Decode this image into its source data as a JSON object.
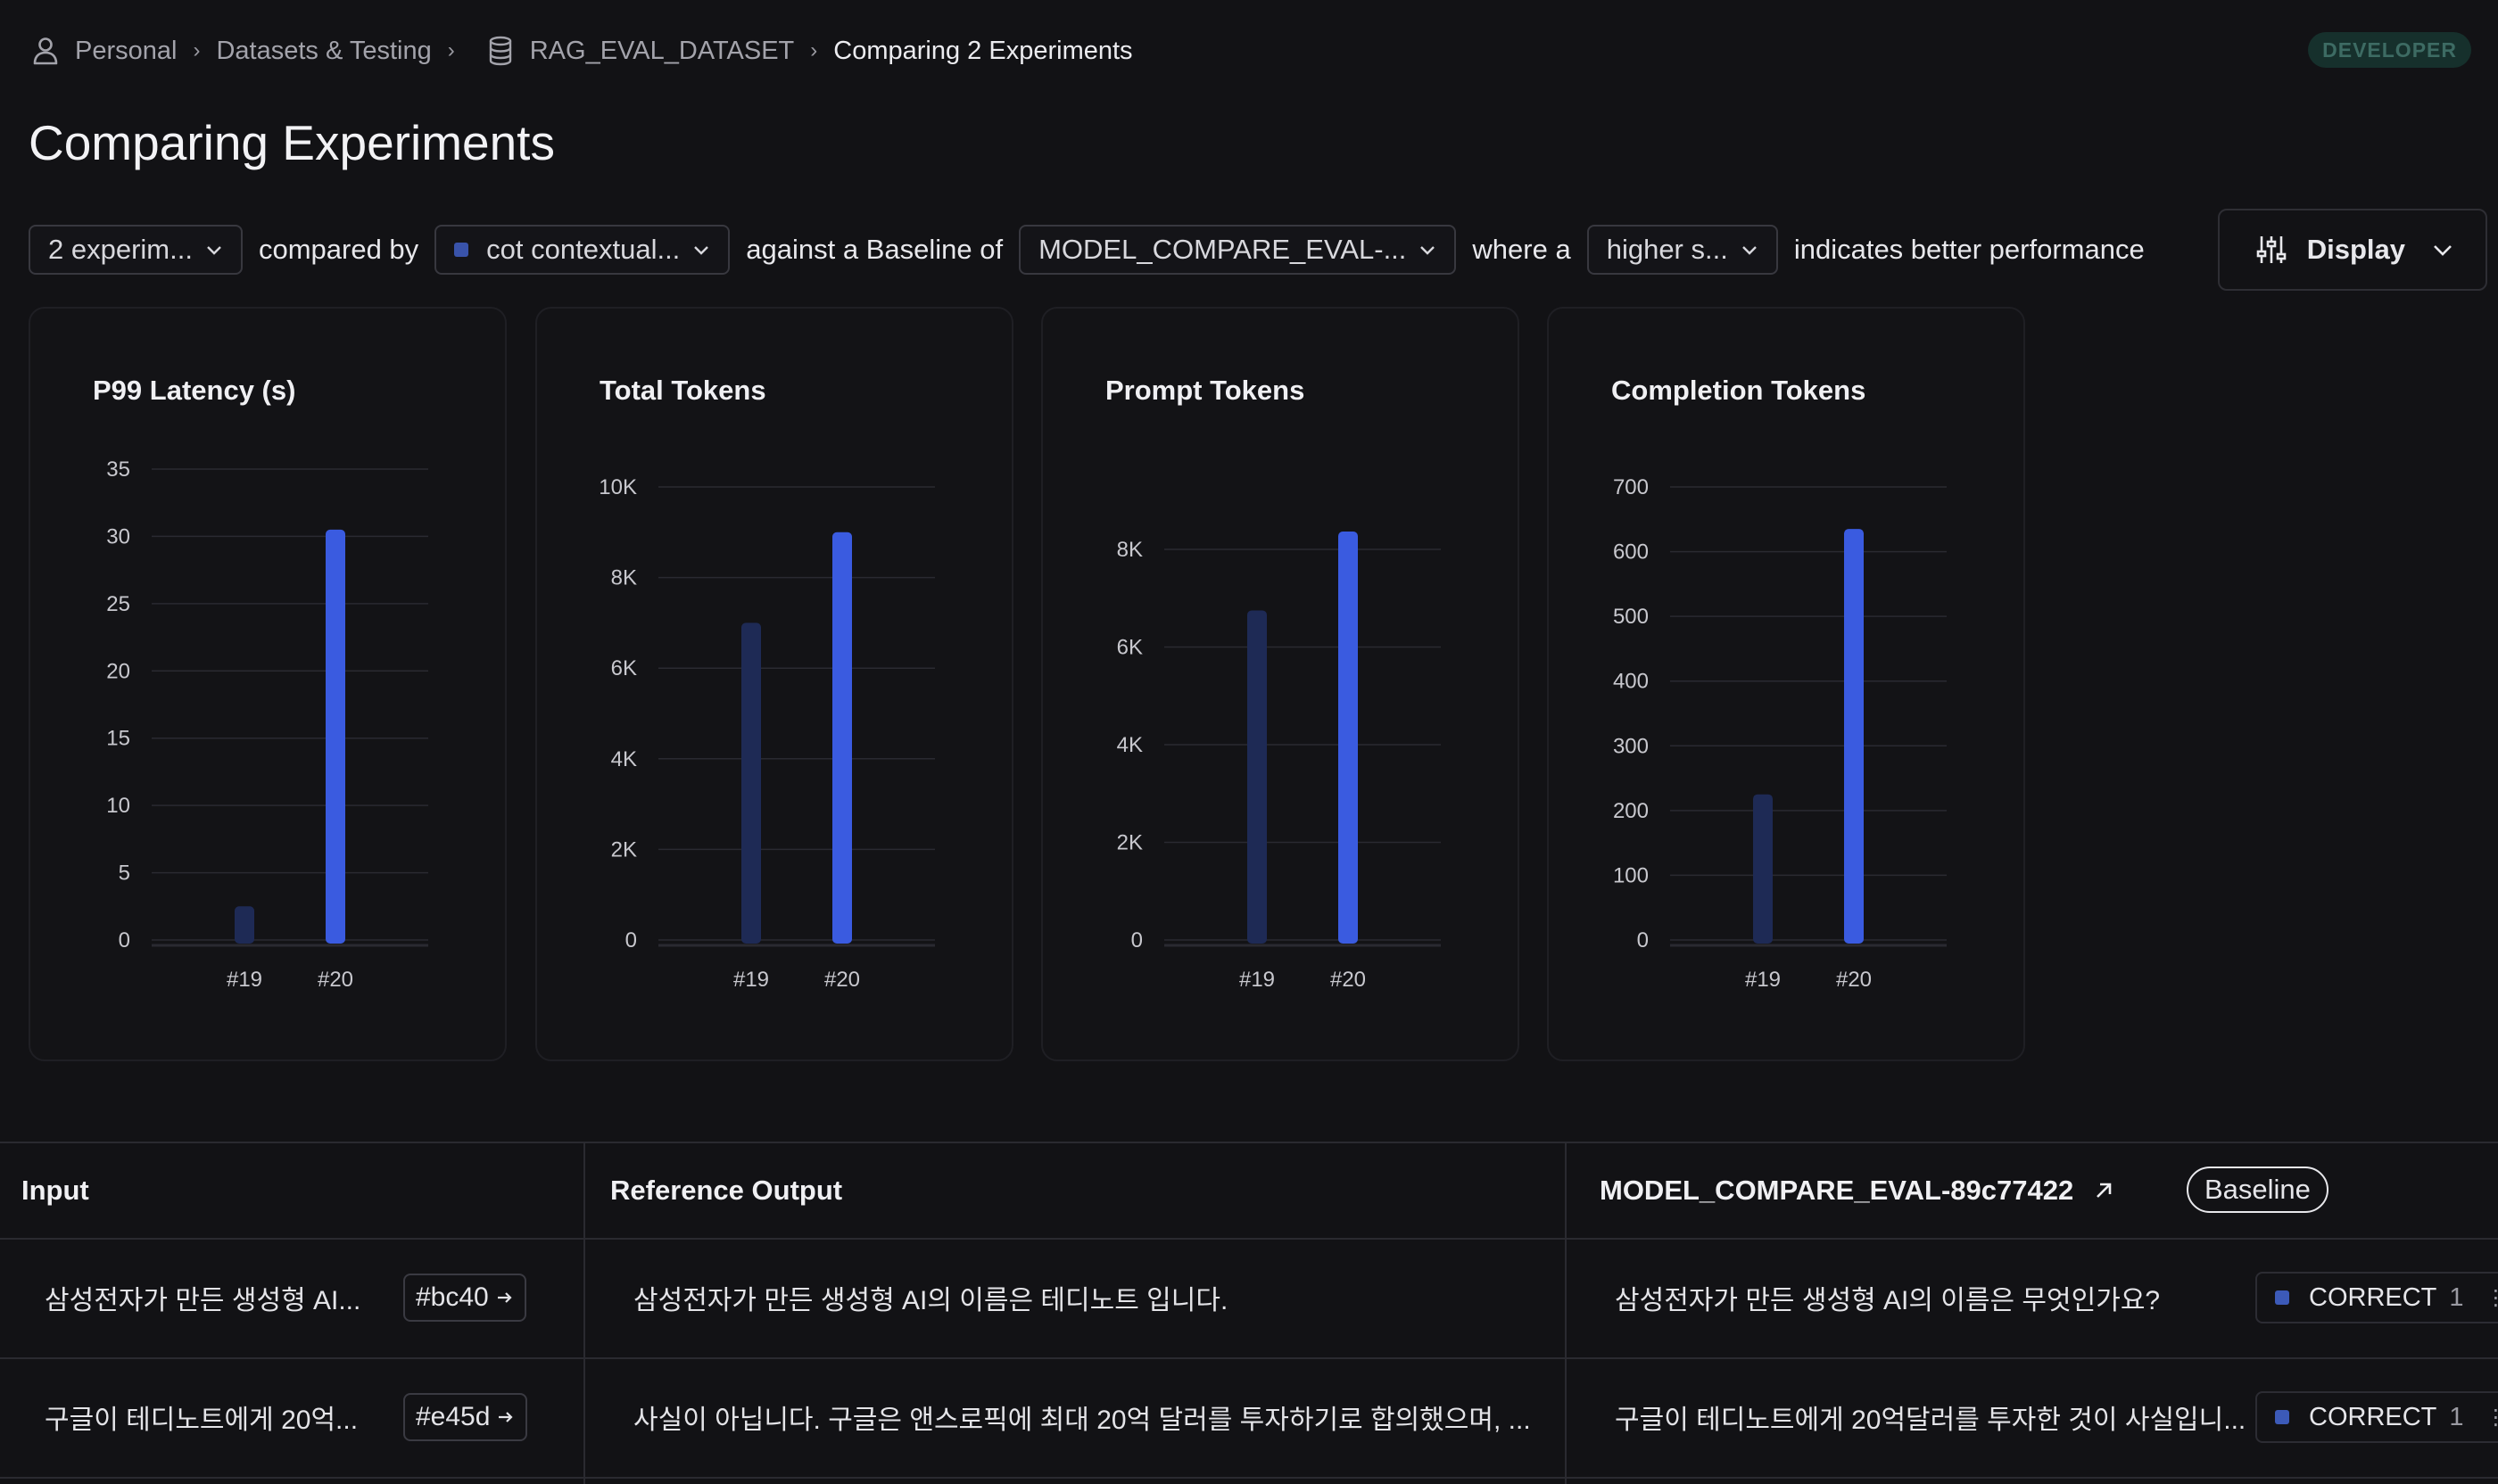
{
  "breadcrumb": {
    "personal": "Personal",
    "datasets": "Datasets & Testing",
    "dataset": "RAG_EVAL_DATASET",
    "current": "Comparing 2 Experiments"
  },
  "badge": "DEVELOPER",
  "page_title": "Comparing Experiments",
  "filters": {
    "experiments": "2 experim...",
    "compared_by_label": "compared by",
    "metric": "cot contextual...",
    "against_label": "against a Baseline of",
    "baseline": "MODEL_COMPARE_EVAL-...",
    "where_label": "where a",
    "direction": "higher s...",
    "indicates_label": "indicates better performance",
    "display_label": "Display"
  },
  "colors": {
    "primary_bar": "#3a5be0",
    "baseline_bar": "#1e2a55",
    "grid": "#2a2a31"
  },
  "chart_data": [
    {
      "type": "bar",
      "title": "P99 Latency (s)",
      "categories": [
        "#19",
        "#20"
      ],
      "values": [
        2.5,
        30.5
      ],
      "ylim": [
        0,
        35
      ],
      "yticks": [
        "0",
        "5",
        "10",
        "15",
        "20",
        "25",
        "30",
        "35"
      ],
      "ytick_values": [
        0,
        5,
        10,
        15,
        20,
        25,
        30,
        35
      ]
    },
    {
      "type": "bar",
      "title": "Total Tokens",
      "categories": [
        "#19",
        "#20"
      ],
      "values": [
        7000,
        9000
      ],
      "ylim": [
        0,
        10000
      ],
      "yticks": [
        "0",
        "2K",
        "4K",
        "6K",
        "8K",
        "10K"
      ],
      "ytick_values": [
        0,
        2000,
        4000,
        6000,
        8000,
        10000
      ]
    },
    {
      "type": "bar",
      "title": "Prompt Tokens",
      "categories": [
        "#19",
        "#20"
      ],
      "values": [
        6750,
        8400
      ],
      "ylim": [
        0,
        8000
      ],
      "yticks": [
        "0",
        "2K",
        "4K",
        "6K",
        "8K"
      ],
      "ytick_values": [
        0,
        2000,
        4000,
        6000,
        8000
      ]
    },
    {
      "type": "bar",
      "title": "Completion Tokens",
      "categories": [
        "#19",
        "#20"
      ],
      "values": [
        225,
        635
      ],
      "ylim": [
        0,
        700
      ],
      "yticks": [
        "0",
        "100",
        "200",
        "300",
        "400",
        "500",
        "600",
        "700"
      ],
      "ytick_values": [
        0,
        100,
        200,
        300,
        400,
        500,
        600,
        700
      ]
    }
  ],
  "table": {
    "headers": {
      "input": "Input",
      "reference": "Reference Output",
      "experiment": "MODEL_COMPARE_EVAL-89c77422",
      "baseline_pill": "Baseline"
    },
    "rows": [
      {
        "input": "삼성전자가 만든 생성형 AI...",
        "hash": "#bc40",
        "reference": "삼성전자가 만든 생성형 AI의 이름은 테디노트 입니다.",
        "output": "삼성전자가 만든 생성형 AI의 이름은 무엇인가요?",
        "score_label": "CORRECT",
        "score_value": "1"
      },
      {
        "input": "구글이 테디노트에게 20억...",
        "hash": "#e45d",
        "reference": "사실이 아닙니다. 구글은 앤스로픽에 최대 20억 달러를 투자하기로 합의했으며, ...",
        "output": "구글이 테디노트에게 20억달러를 투자한 것이 사실입니...",
        "score_label": "CORRECT",
        "score_value": "1"
      }
    ]
  }
}
